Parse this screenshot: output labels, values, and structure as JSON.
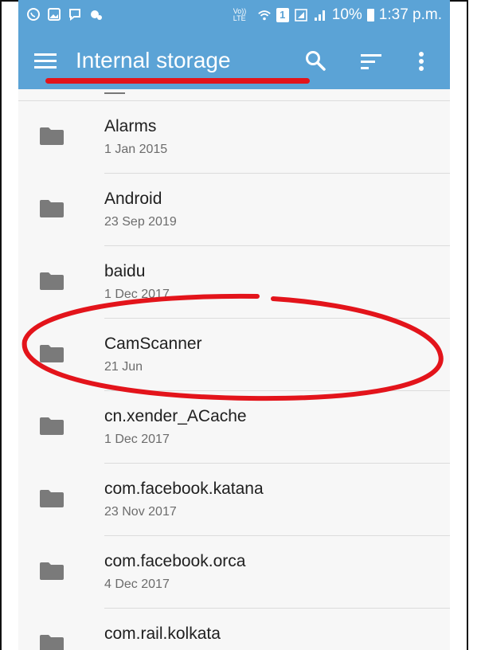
{
  "status_bar": {
    "left_icons": [
      "whatsapp-icon",
      "gallery-icon",
      "message-icon",
      "settings-icon"
    ],
    "network_label": "Vo)) LTE",
    "sim_label": "1",
    "battery": "10%",
    "time": "1:37 p.m."
  },
  "app_bar": {
    "title": "Internal storage",
    "icons": [
      "menu-icon",
      "search-icon",
      "sort-icon",
      "more-icon"
    ]
  },
  "files": [
    {
      "name": "Alarms",
      "date": "1 Jan 2015"
    },
    {
      "name": "Android",
      "date": "23 Sep 2019"
    },
    {
      "name": "baidu",
      "date": "1 Dec 2017"
    },
    {
      "name": "CamScanner",
      "date": "21 Jun"
    },
    {
      "name": "cn.xender_ACache",
      "date": "1 Dec 2017"
    },
    {
      "name": "com.facebook.katana",
      "date": "23 Nov 2017"
    },
    {
      "name": "com.facebook.orca",
      "date": "4 Dec 2017"
    },
    {
      "name": "com.rail.kolkata",
      "date": ""
    }
  ],
  "colors": {
    "app_bar": "#5ba3d6",
    "annotation": "#e3141b",
    "folder": "#7a7a7a"
  }
}
